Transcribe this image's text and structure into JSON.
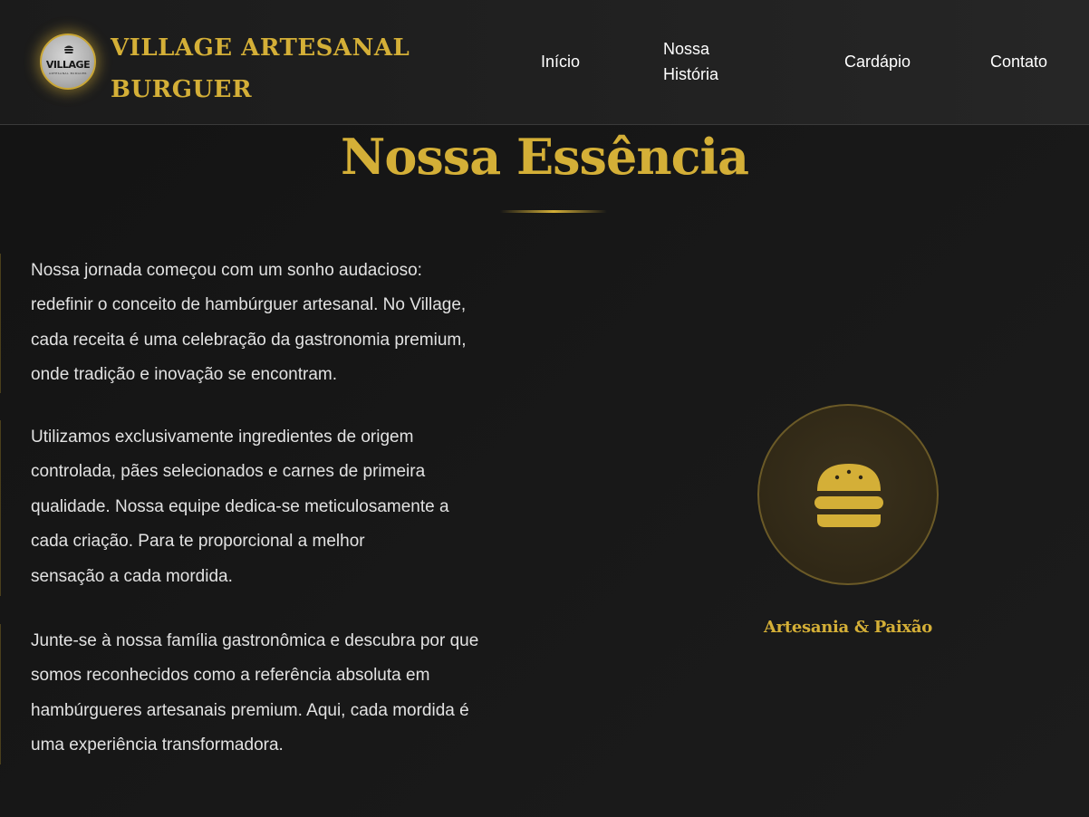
{
  "header": {
    "logo_text": "VILLAGE",
    "logo_subtext": "ARTESANAL BURGUER",
    "brand_line_1": "VILLAGE ARTESANAL",
    "brand_line_2": "BURGUER",
    "nav": {
      "inicio": "Início",
      "historia": "Nossa História",
      "cardapio": "Cardápio",
      "contato": "Contato"
    }
  },
  "section": {
    "title": "Nossa Essência",
    "paragraphs": [
      {
        "lines": [
          "Nossa jornada começou com um sonho audacioso:",
          "redefinir o conceito de hambúrguer artesanal. No Village,",
          "cada receita é uma celebração da gastronomia premium,",
          "onde tradição e inovação se encontram."
        ]
      },
      {
        "lines": [
          "Utilizamos exclusivamente ingredientes de origem",
          "controlada, pães selecionados e carnes de primeira",
          "qualidade. Nossa equipe dedica-se meticulosamente a",
          "cada criação. Para te proporcional a melhor",
          "sensação a cada mordida."
        ]
      },
      {
        "lines": [
          "Junte-se à nossa família gastronômica e descubra por que",
          "somos reconhecidos como a referência absoluta em",
          "hambúrgueres artesanais premium. Aqui, cada mordida é",
          "uma experiência transformadora."
        ]
      }
    ],
    "feature": {
      "icon": "burger-icon",
      "label": "Artesania & Paixão"
    }
  },
  "colors": {
    "accent": "#d4af37",
    "background": "#141414",
    "header_bg": "#202020",
    "text": "#e2e2e2",
    "nav_text": "#ffffff"
  }
}
